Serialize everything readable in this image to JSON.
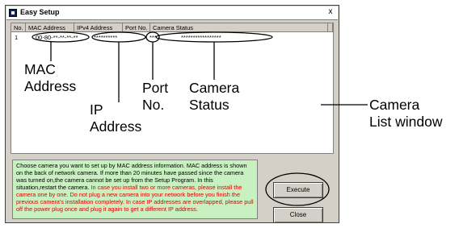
{
  "window": {
    "title": "Easy Setup",
    "close_label": "x"
  },
  "list": {
    "columns": [
      "No.",
      "MAC Address",
      "IPv4 Address",
      "Port No.",
      "Camera Status"
    ],
    "rows": [
      {
        "no": "1",
        "mac": "00-80-**-**-**-**",
        "ip": "**********",
        "port": "***",
        "status": "*****************"
      }
    ]
  },
  "info": {
    "black_text": "Choose camera you want to set up by MAC address information. MAC address is shown on the back of network camera. If more than 20 minutes have passed since the camera was turned on,the camera cannot be set up from the Setup Program. In this situation,restart the camera.",
    "red_text": "In case you install two or more cameras, please install the camera one by one. Do not plug a new camera into your network before you finish the previous camera's installation completely. In case IP addresses are overlapped, please pull off the power plug once and plug it again to get a different IP address."
  },
  "buttons": {
    "execute": "Execute",
    "close": "Close"
  },
  "annotations": {
    "mac": [
      "MAC",
      "Address"
    ],
    "ip": [
      "IP",
      "Address"
    ],
    "port": [
      "Port",
      "No."
    ],
    "status": [
      "Camera",
      "Status"
    ],
    "list_window": [
      "Camera",
      "List window"
    ]
  }
}
